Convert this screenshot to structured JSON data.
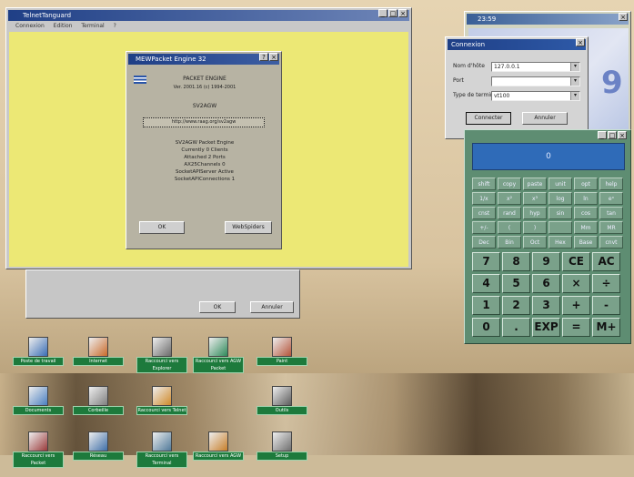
{
  "colors": {
    "yellow_bg": "#ece875",
    "desktop": "#d9c7a6",
    "titlebar_blue": "#1f3f86",
    "calc_green": "#5e8d72",
    "calc_display": "#2f6bb8",
    "icon_label": "#1d7a3c"
  },
  "notepad": {
    "title": "TelnetTanguard",
    "menu": [
      "Connexion",
      "Edition",
      "Terminal",
      "?"
    ]
  },
  "about": {
    "title": "MEWPacket Engine 32",
    "line1": "PACKET ENGINE",
    "line2": "Ver. 2001.16 (c) 1994-2001",
    "line3": "SV2AGW",
    "url": "http://www.raag.org/sv2agw",
    "status": [
      "SV2AGW Packet Engine",
      "Currently 0 Clients",
      "Attached 2 Ports",
      "AX25Channels 0",
      "SocketAPIServer Active",
      "SocketAPIConnections 1"
    ],
    "ok_label": "OK",
    "web_label": "WebSpiders"
  },
  "behind_dialog": {
    "ok_label": "OK",
    "cancel_label": "Annuler"
  },
  "clock": {
    "time": "23:59"
  },
  "connect": {
    "title": "Connexion",
    "host_label": "Nom d'hôte",
    "host_value": "127.0.0.1",
    "port_label": "Port",
    "port_value": "",
    "term_label": "Type de terminal",
    "term_value": "vt100",
    "connect_label": "Connecter",
    "cancel_label": "Annuler"
  },
  "calculator": {
    "display": "0",
    "small_keys": [
      [
        "shift",
        "copy",
        "paste",
        "unit",
        "opt",
        "help"
      ],
      [
        "1/x",
        "x²",
        "x³",
        "log",
        "ln",
        "eˣ"
      ],
      [
        "cnst",
        "rand",
        "hyp",
        "sin",
        "cos",
        "tan"
      ],
      [
        "+/-",
        "(",
        ")",
        "",
        "Mm",
        "MR"
      ],
      [
        "Dec",
        "Bin",
        "Oct",
        "Hex",
        "Base",
        "cnvt"
      ]
    ],
    "big_keys": [
      [
        "7",
        "8",
        "9",
        "CE",
        "AC"
      ],
      [
        "4",
        "5",
        "6",
        "×",
        "÷"
      ],
      [
        "1",
        "2",
        "3",
        "+",
        "-"
      ],
      [
        "0",
        ".",
        "EXP",
        "=",
        "M+"
      ]
    ]
  },
  "desktop_icons": [
    {
      "label": "Poste de travail"
    },
    {
      "label": "Internet"
    },
    {
      "label": "Raccourci vers Explorer"
    },
    {
      "label": "Raccourci vers AGW Packet"
    },
    {
      "label": "Paint"
    },
    {
      "label": "Documents"
    },
    {
      "label": "Corbeille"
    },
    {
      "label": "Raccourci vers Telnet"
    },
    {
      "label": "Outils"
    },
    {
      "label": "Raccourci vers Packet"
    },
    {
      "label": "Réseau"
    },
    {
      "label": "Raccourci vers Terminal"
    },
    {
      "label": "Raccourci vers AGW"
    },
    {
      "label": "Setup"
    }
  ]
}
